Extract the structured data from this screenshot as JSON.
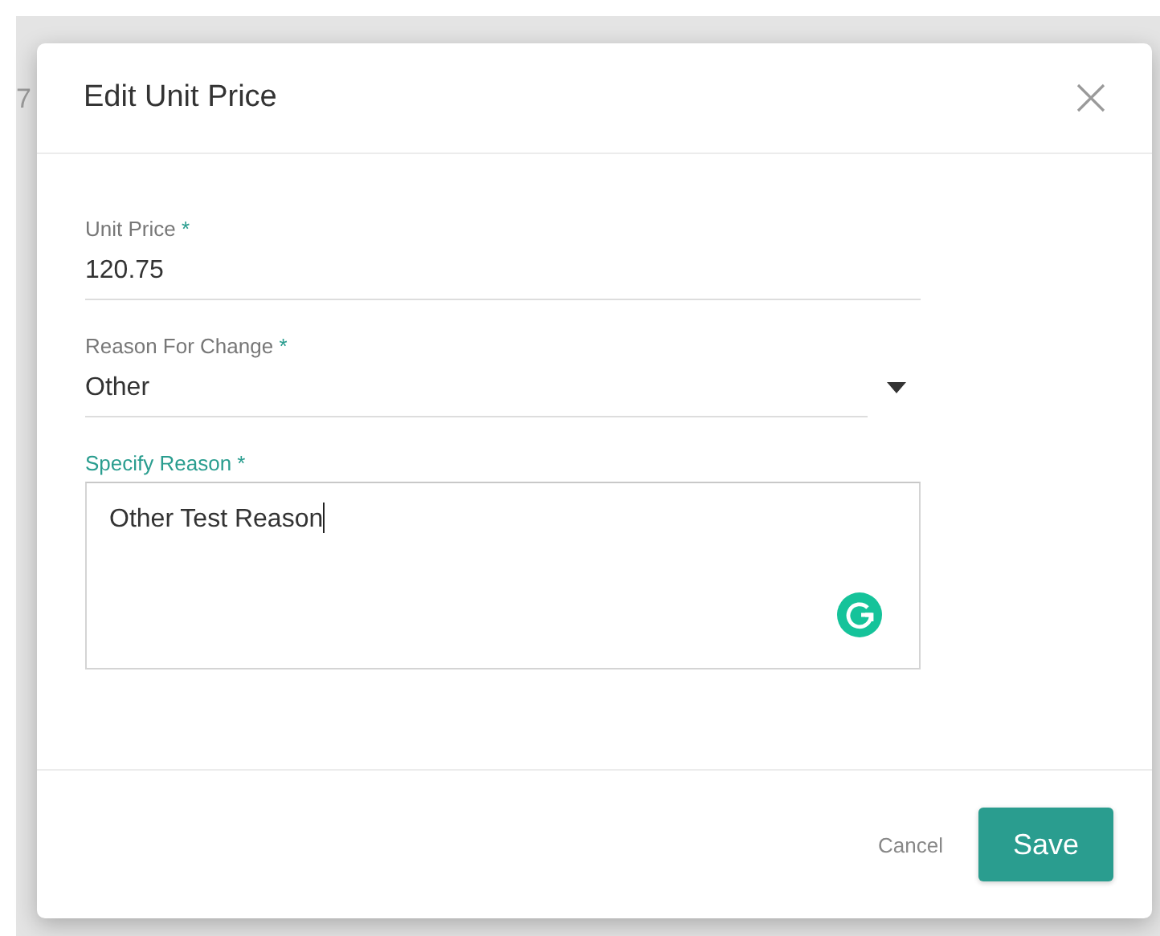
{
  "background": {
    "text_fragment": "7"
  },
  "dialog": {
    "title": "Edit Unit Price"
  },
  "fields": [
    {
      "kind": "text",
      "label": "Unit Price",
      "required_mark": "*",
      "value": "120.75",
      "focused": false
    },
    {
      "kind": "select",
      "label": "Reason For Change",
      "required_mark": "*",
      "value": "Other",
      "focused": false
    },
    {
      "kind": "textarea",
      "label": "Specify Reason",
      "required_mark": "*",
      "value": "Other Test Reason",
      "focused": true
    }
  ],
  "buttons": [
    {
      "label": "Cancel",
      "kind": "text"
    },
    {
      "label": "Save",
      "kind": "primary"
    }
  ]
}
